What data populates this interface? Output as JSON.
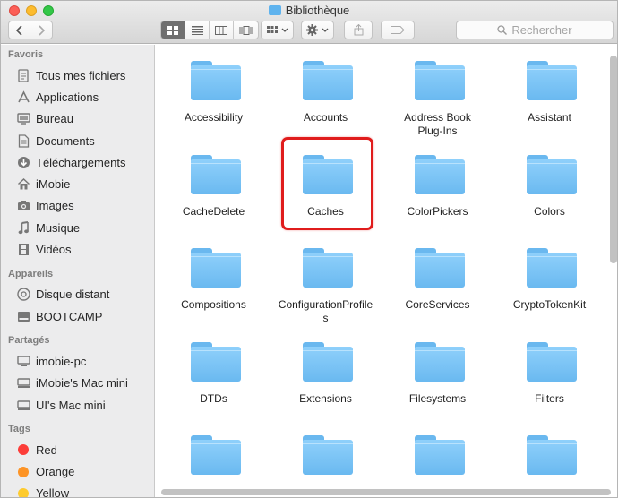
{
  "window": {
    "title": "Bibliothèque",
    "title_icon": "folder-icon"
  },
  "toolbar": {
    "back_icon": "chevron-left-icon",
    "forward_icon": "chevron-right-icon",
    "view_modes": [
      "icon-view",
      "list-view",
      "column-view",
      "cover-flow-view"
    ],
    "active_view": "icon-view",
    "arrange_icon": "grid-icon",
    "action_icon": "gear-icon",
    "share_icon": "share-icon",
    "tag_icon": "tag-icon",
    "search_placeholder": "Rechercher"
  },
  "sidebar": {
    "favorites_title": "Favoris",
    "favorites": [
      {
        "label": "Tous mes fichiers",
        "icon": "all-files-icon"
      },
      {
        "label": "Applications",
        "icon": "applications-icon"
      },
      {
        "label": "Bureau",
        "icon": "desktop-icon"
      },
      {
        "label": "Documents",
        "icon": "documents-icon"
      },
      {
        "label": "Téléchargements",
        "icon": "downloads-icon"
      },
      {
        "label": "iMobie",
        "icon": "home-icon"
      },
      {
        "label": "Images",
        "icon": "camera-icon"
      },
      {
        "label": "Musique",
        "icon": "music-icon"
      },
      {
        "label": "Vidéos",
        "icon": "film-icon"
      }
    ],
    "devices_title": "Appareils",
    "devices": [
      {
        "label": "Disque distant",
        "icon": "disc-icon"
      },
      {
        "label": "BOOTCAMP",
        "icon": "drive-icon"
      }
    ],
    "shared_title": "Partagés",
    "shared": [
      {
        "label": "imobie-pc",
        "icon": "pc-icon"
      },
      {
        "label": "iMobie's Mac mini",
        "icon": "mac-mini-icon"
      },
      {
        "label": "UI's Mac mini",
        "icon": "mac-mini-icon"
      }
    ],
    "tags_title": "Tags",
    "tags": [
      {
        "label": "Red",
        "color": "#fc3d39"
      },
      {
        "label": "Orange",
        "color": "#fd9426"
      },
      {
        "label": "Yellow",
        "color": "#fecb2e"
      }
    ]
  },
  "folders": [
    "Accessibility",
    "Accounts",
    "Address Book\nPlug-Ins",
    "Assistant",
    "CacheDelete",
    "Caches",
    "ColorPickers",
    "Colors",
    "Compositions",
    "ConfigurationProfile\ns",
    "CoreServices",
    "CryptoTokenKit",
    "DTDs",
    "Extensions",
    "Filesystems",
    "Filters",
    "",
    "",
    "",
    ""
  ],
  "highlighted_folder": "Caches",
  "colors": {
    "folder": "#7cc4f6",
    "highlight": "#e01c1c",
    "sidebar_bg": "#ececed"
  }
}
